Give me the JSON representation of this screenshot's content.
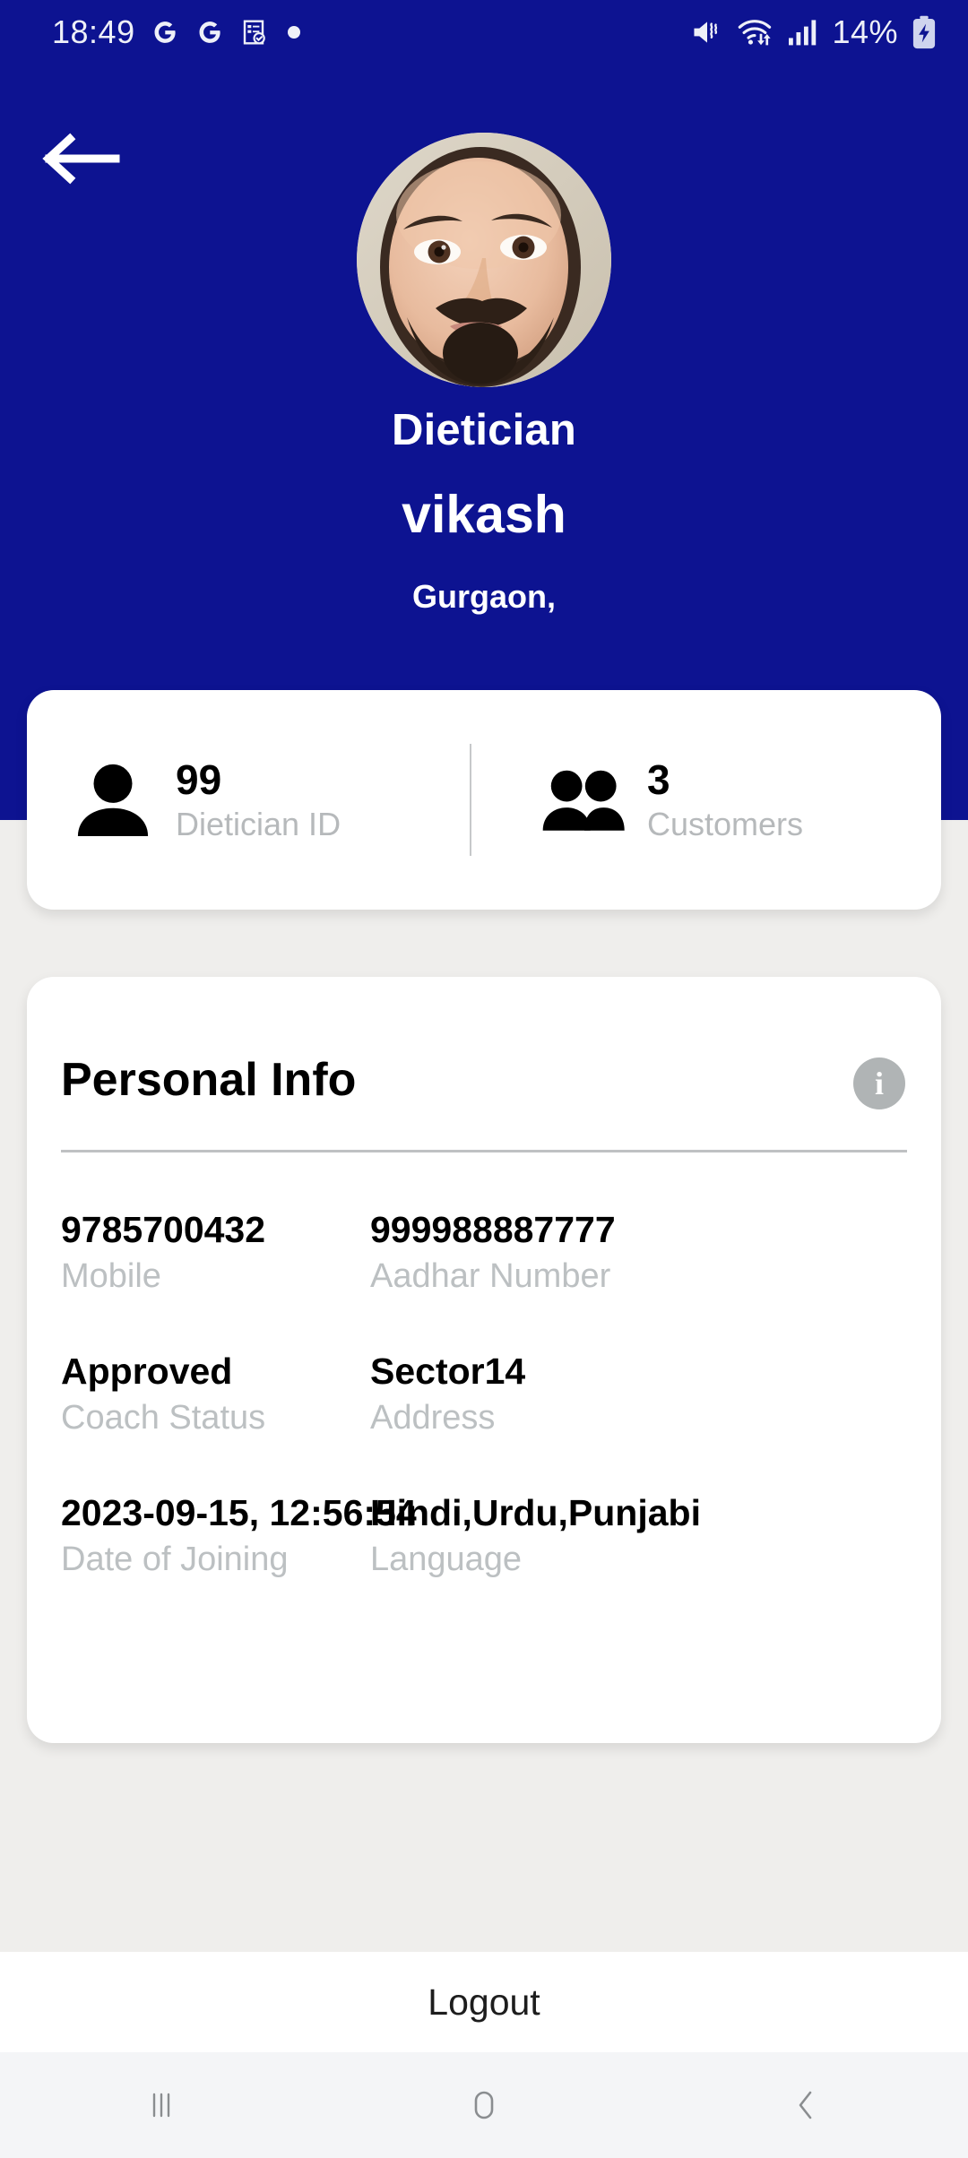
{
  "statusbar": {
    "time": "18:49",
    "battery_percent": "14%",
    "left_icons": [
      "google-g-icon",
      "google-g-icon",
      "form-check-icon",
      "dot-icon"
    ],
    "right_icons": [
      "mute-icon",
      "wifi-icon",
      "signal-bars-icon",
      "battery-charging-icon"
    ]
  },
  "header": {
    "back_icon": "back-arrow-icon",
    "avatar": "profile-photo",
    "role": "Dietician",
    "name": "vikash",
    "city": "Gurgaon,",
    "background_color": "#0d1391"
  },
  "stats": [
    {
      "icon": "person-icon",
      "value": "99",
      "label": "Dietician ID"
    },
    {
      "icon": "people-icon",
      "value": "3",
      "label": "Customers"
    }
  ],
  "personal_info": {
    "title": "Personal Info",
    "info_icon": "info-icon",
    "info_icon_letter": "i",
    "rows": [
      [
        {
          "value": "9785700432",
          "label": "Mobile"
        },
        {
          "value": "999988887777",
          "label": "Aadhar Number"
        }
      ],
      [
        {
          "value": "Approved",
          "label": "Coach Status"
        },
        {
          "value": "Sector14",
          "label": "Address"
        }
      ],
      [
        {
          "value": "2023-09-15, 12:56:54",
          "label": "Date of Joining"
        },
        {
          "value": "Hindi,Urdu,Punjabi",
          "label": "Language"
        }
      ]
    ]
  },
  "footer": {
    "logout_label": "Logout"
  },
  "navbar": {
    "items": [
      "recents-icon",
      "home-icon",
      "back-icon"
    ]
  }
}
